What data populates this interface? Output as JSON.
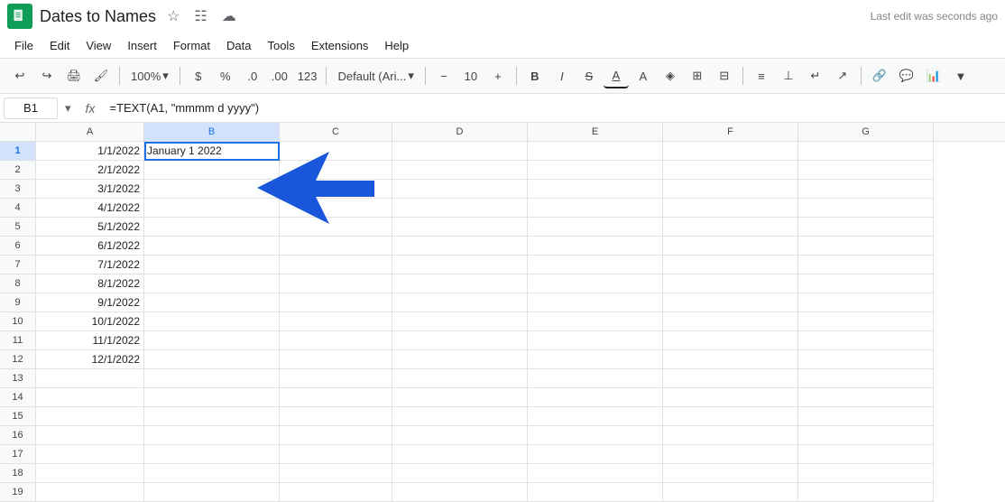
{
  "titleBar": {
    "appIconAlt": "Google Sheets",
    "docTitle": "Dates to Names",
    "lastEdit": "Last edit was seconds ago"
  },
  "menuBar": {
    "items": [
      "File",
      "Edit",
      "View",
      "Insert",
      "Format",
      "Data",
      "Tools",
      "Extensions",
      "Help"
    ]
  },
  "toolbar": {
    "zoom": "100%",
    "currency": "$",
    "percent": "%",
    "decimal0": ".0",
    "decimal00": ".00",
    "format123": "123",
    "font": "Default (Ari...",
    "fontSize": "10",
    "boldLabel": "B",
    "italicLabel": "I",
    "strikeLabel": "S",
    "underlineLabel": "A"
  },
  "formulaBar": {
    "cellRef": "B1",
    "formula": "=TEXT(A1, \"mmmm d yyyy\")"
  },
  "columns": {
    "headers": [
      "A",
      "B",
      "C",
      "D",
      "E",
      "F",
      "G"
    ],
    "widths": [
      120,
      150,
      125,
      150,
      150,
      150,
      150
    ]
  },
  "rows": [
    {
      "num": 1,
      "a": "1/1/2022",
      "b": "January 1 2022"
    },
    {
      "num": 2,
      "a": "2/1/2022",
      "b": ""
    },
    {
      "num": 3,
      "a": "3/1/2022",
      "b": ""
    },
    {
      "num": 4,
      "a": "4/1/2022",
      "b": ""
    },
    {
      "num": 5,
      "a": "5/1/2022",
      "b": ""
    },
    {
      "num": 6,
      "a": "6/1/2022",
      "b": ""
    },
    {
      "num": 7,
      "a": "7/1/2022",
      "b": ""
    },
    {
      "num": 8,
      "a": "8/1/2022",
      "b": ""
    },
    {
      "num": 9,
      "a": "9/1/2022",
      "b": ""
    },
    {
      "num": 10,
      "a": "10/1/2022",
      "b": ""
    },
    {
      "num": 11,
      "a": "11/1/2022",
      "b": ""
    },
    {
      "num": 12,
      "a": "12/1/2022",
      "b": ""
    },
    {
      "num": 13,
      "a": "",
      "b": ""
    },
    {
      "num": 14,
      "a": "",
      "b": ""
    },
    {
      "num": 15,
      "a": "",
      "b": ""
    },
    {
      "num": 16,
      "a": "",
      "b": ""
    },
    {
      "num": 17,
      "a": "",
      "b": ""
    },
    {
      "num": 18,
      "a": "",
      "b": ""
    },
    {
      "num": 19,
      "a": "",
      "b": ""
    }
  ]
}
